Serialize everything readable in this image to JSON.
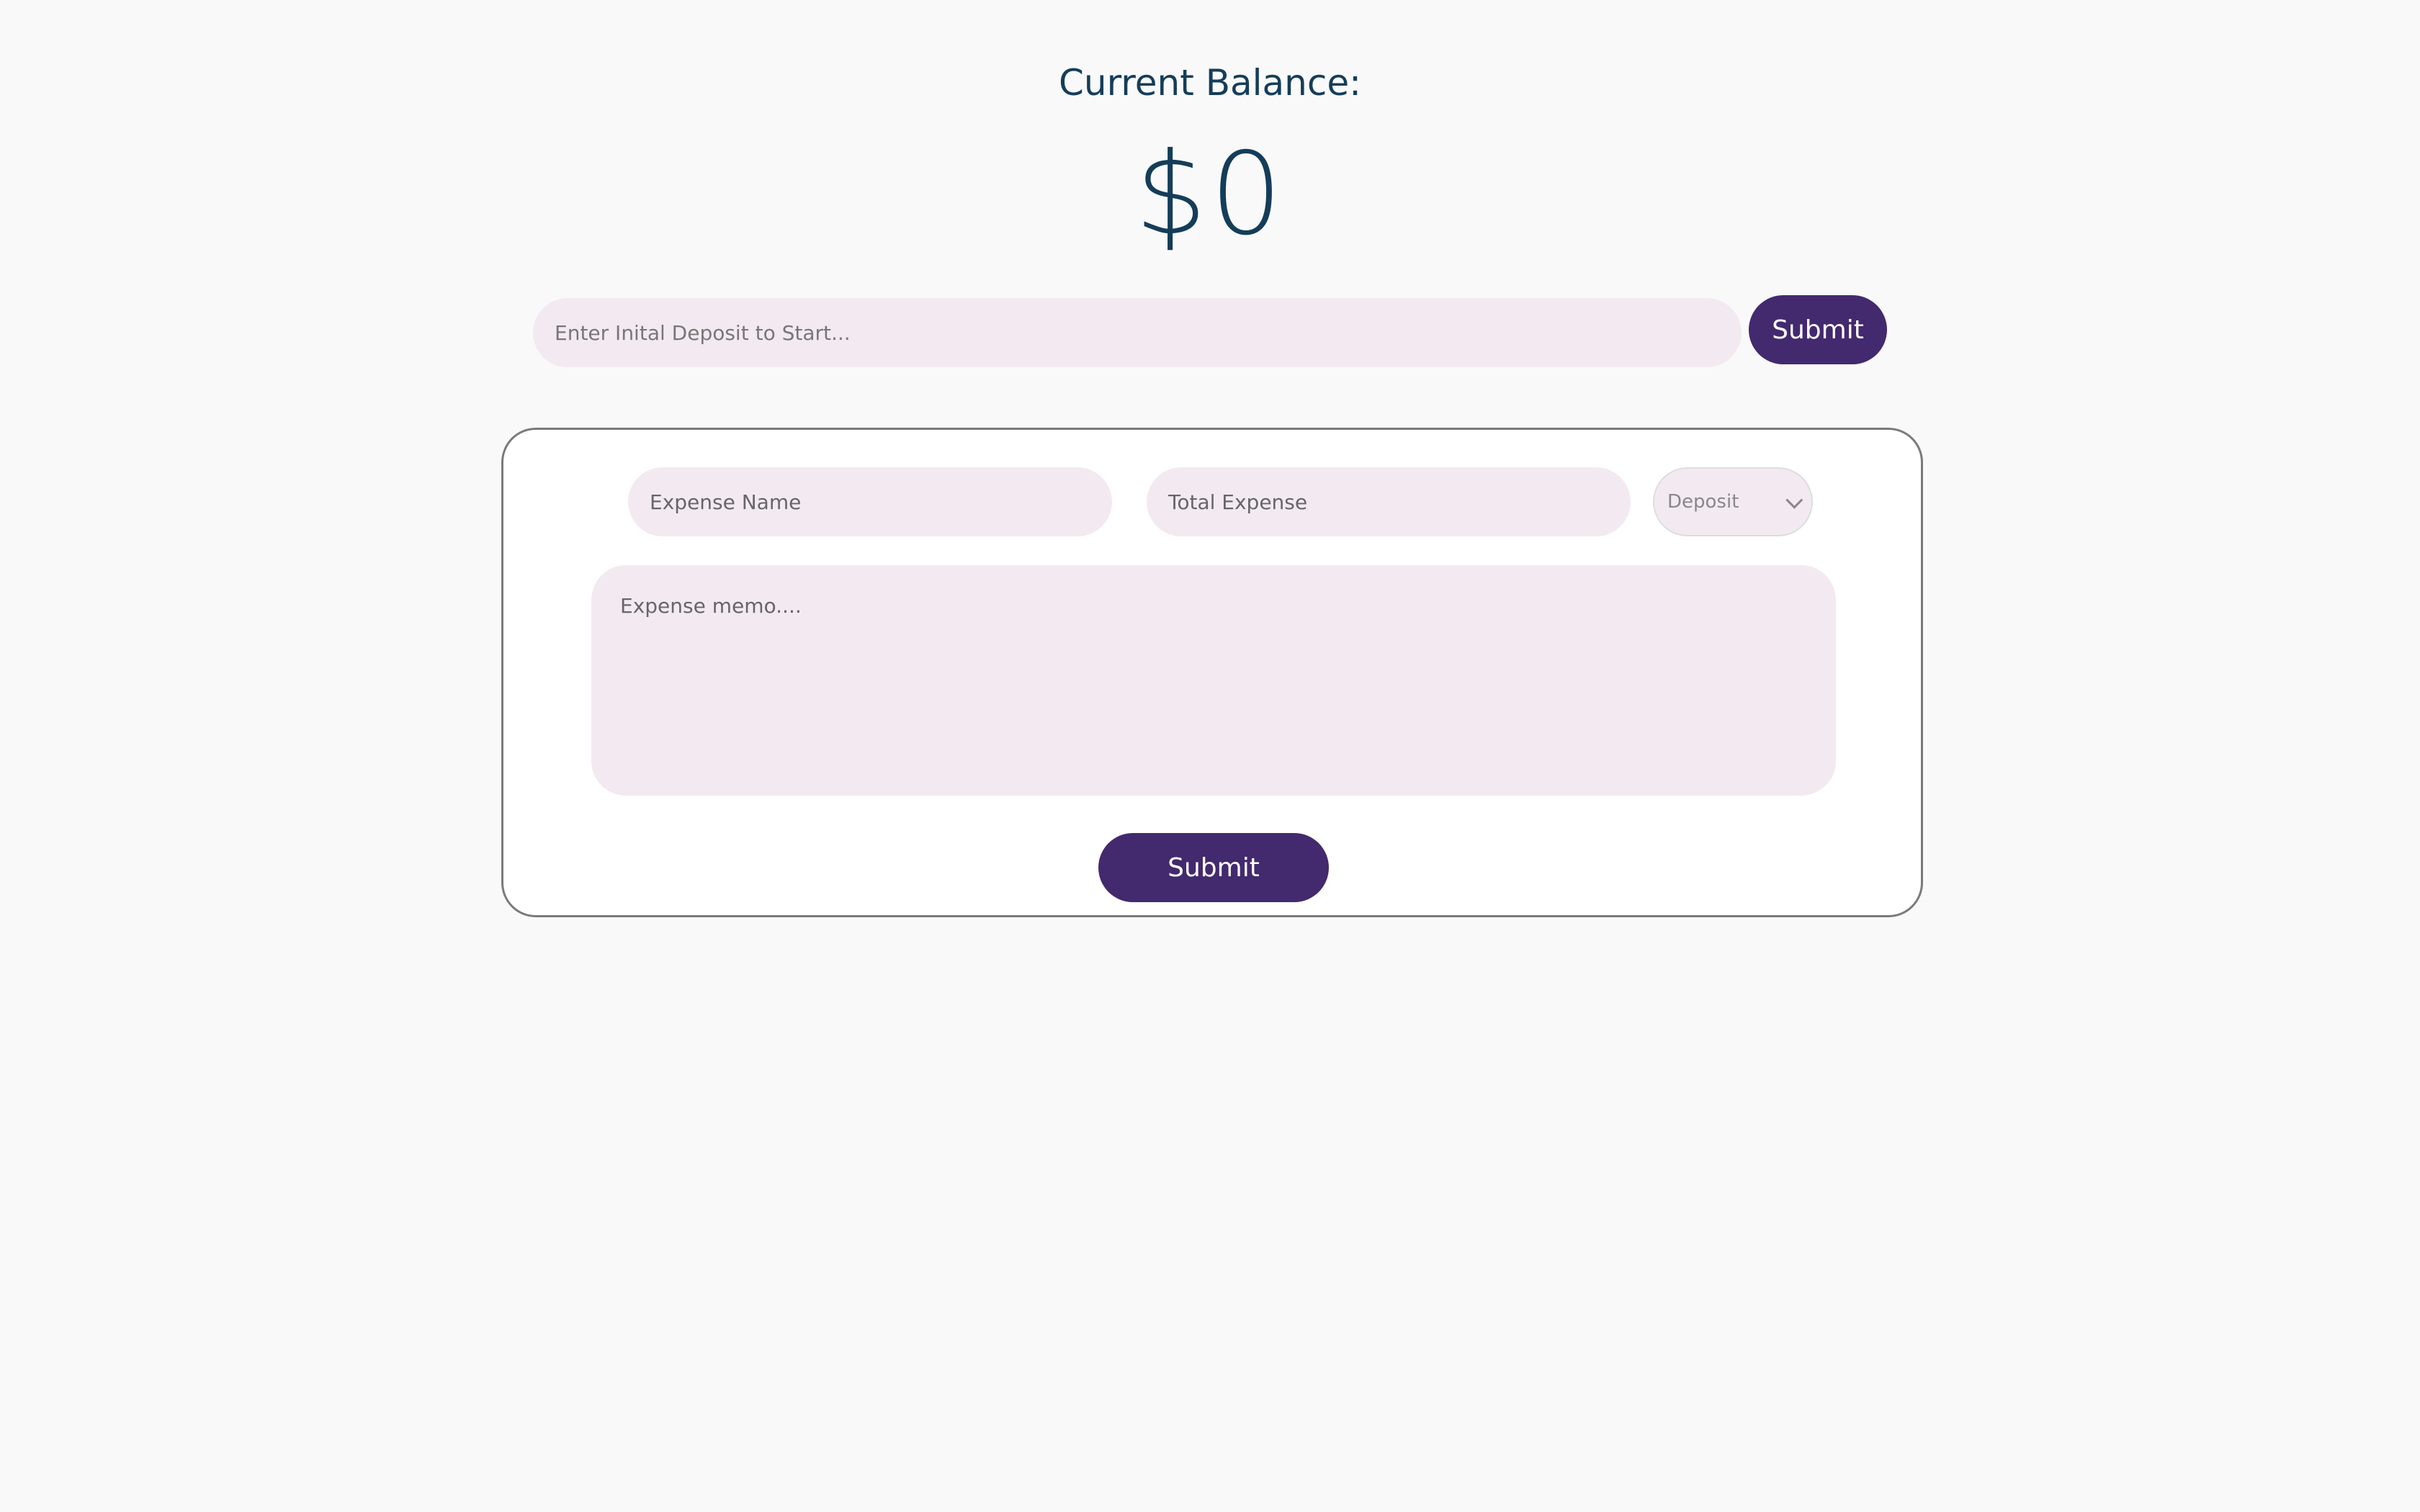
{
  "balance": {
    "label": "Current Balance:",
    "value": "$0"
  },
  "deposit": {
    "placeholder": "Enter Inital Deposit to Start...",
    "value": "",
    "submit_label": "Submit"
  },
  "expense_form": {
    "name_placeholder": "Expense Name",
    "name_value": "",
    "total_placeholder": "Total Expense",
    "total_value": "",
    "type_selected": "Deposit",
    "memo_placeholder": "Expense memo....",
    "memo_value": "",
    "submit_label": "Submit"
  },
  "colors": {
    "background": "#f9f9f9",
    "text": "#143d59",
    "button": "#43296e",
    "input": "#f3eaf1"
  },
  "icons": {
    "select": "chevron-down-icon"
  }
}
